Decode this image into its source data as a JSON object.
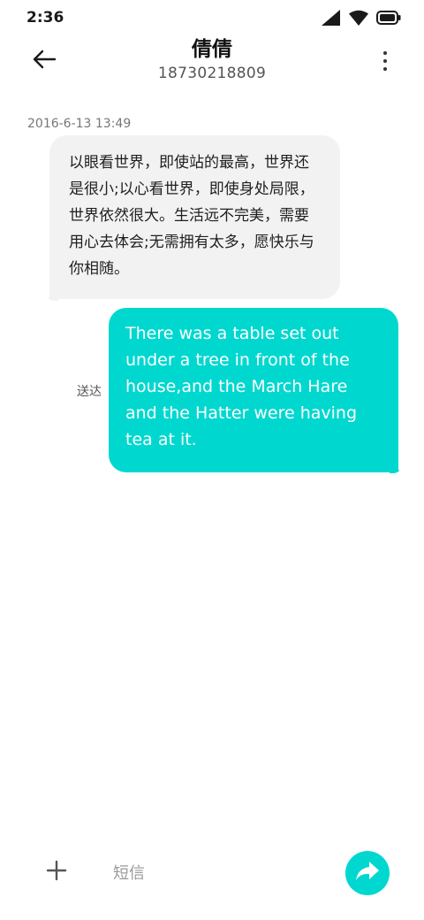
{
  "status_bar": {
    "time": "2:36",
    "icons": [
      "signal-icon",
      "wifi-icon",
      "battery-icon"
    ]
  },
  "header": {
    "contact_name": "倩倩",
    "contact_number": "18730218809",
    "back_icon": "back-arrow-icon",
    "more_icon": "more-vertical-icon"
  },
  "conversation": {
    "timestamp": "2016-6-13 13:49",
    "incoming": {
      "text": "以眼看世界，即使站的最高，世界还是很小;以心看世界，即使身处局限，世界依然很大。生活远不完美，需要用心去体会;无需拥有太多，愿快乐与你相随。"
    },
    "outgoing": {
      "text": "There was a table set out under a tree in front of the house,and the March Hare and the Hatter were having tea at it.",
      "status": "送达"
    }
  },
  "composer": {
    "placeholder": "短信",
    "value": "",
    "add_icon": "plus-icon",
    "send_icon": "send-arrow-icon"
  },
  "colors": {
    "accent": "#00d8cf",
    "incoming_bubble": "#f2f2f2",
    "text_primary": "#1a1a1a",
    "text_secondary": "#777777"
  }
}
